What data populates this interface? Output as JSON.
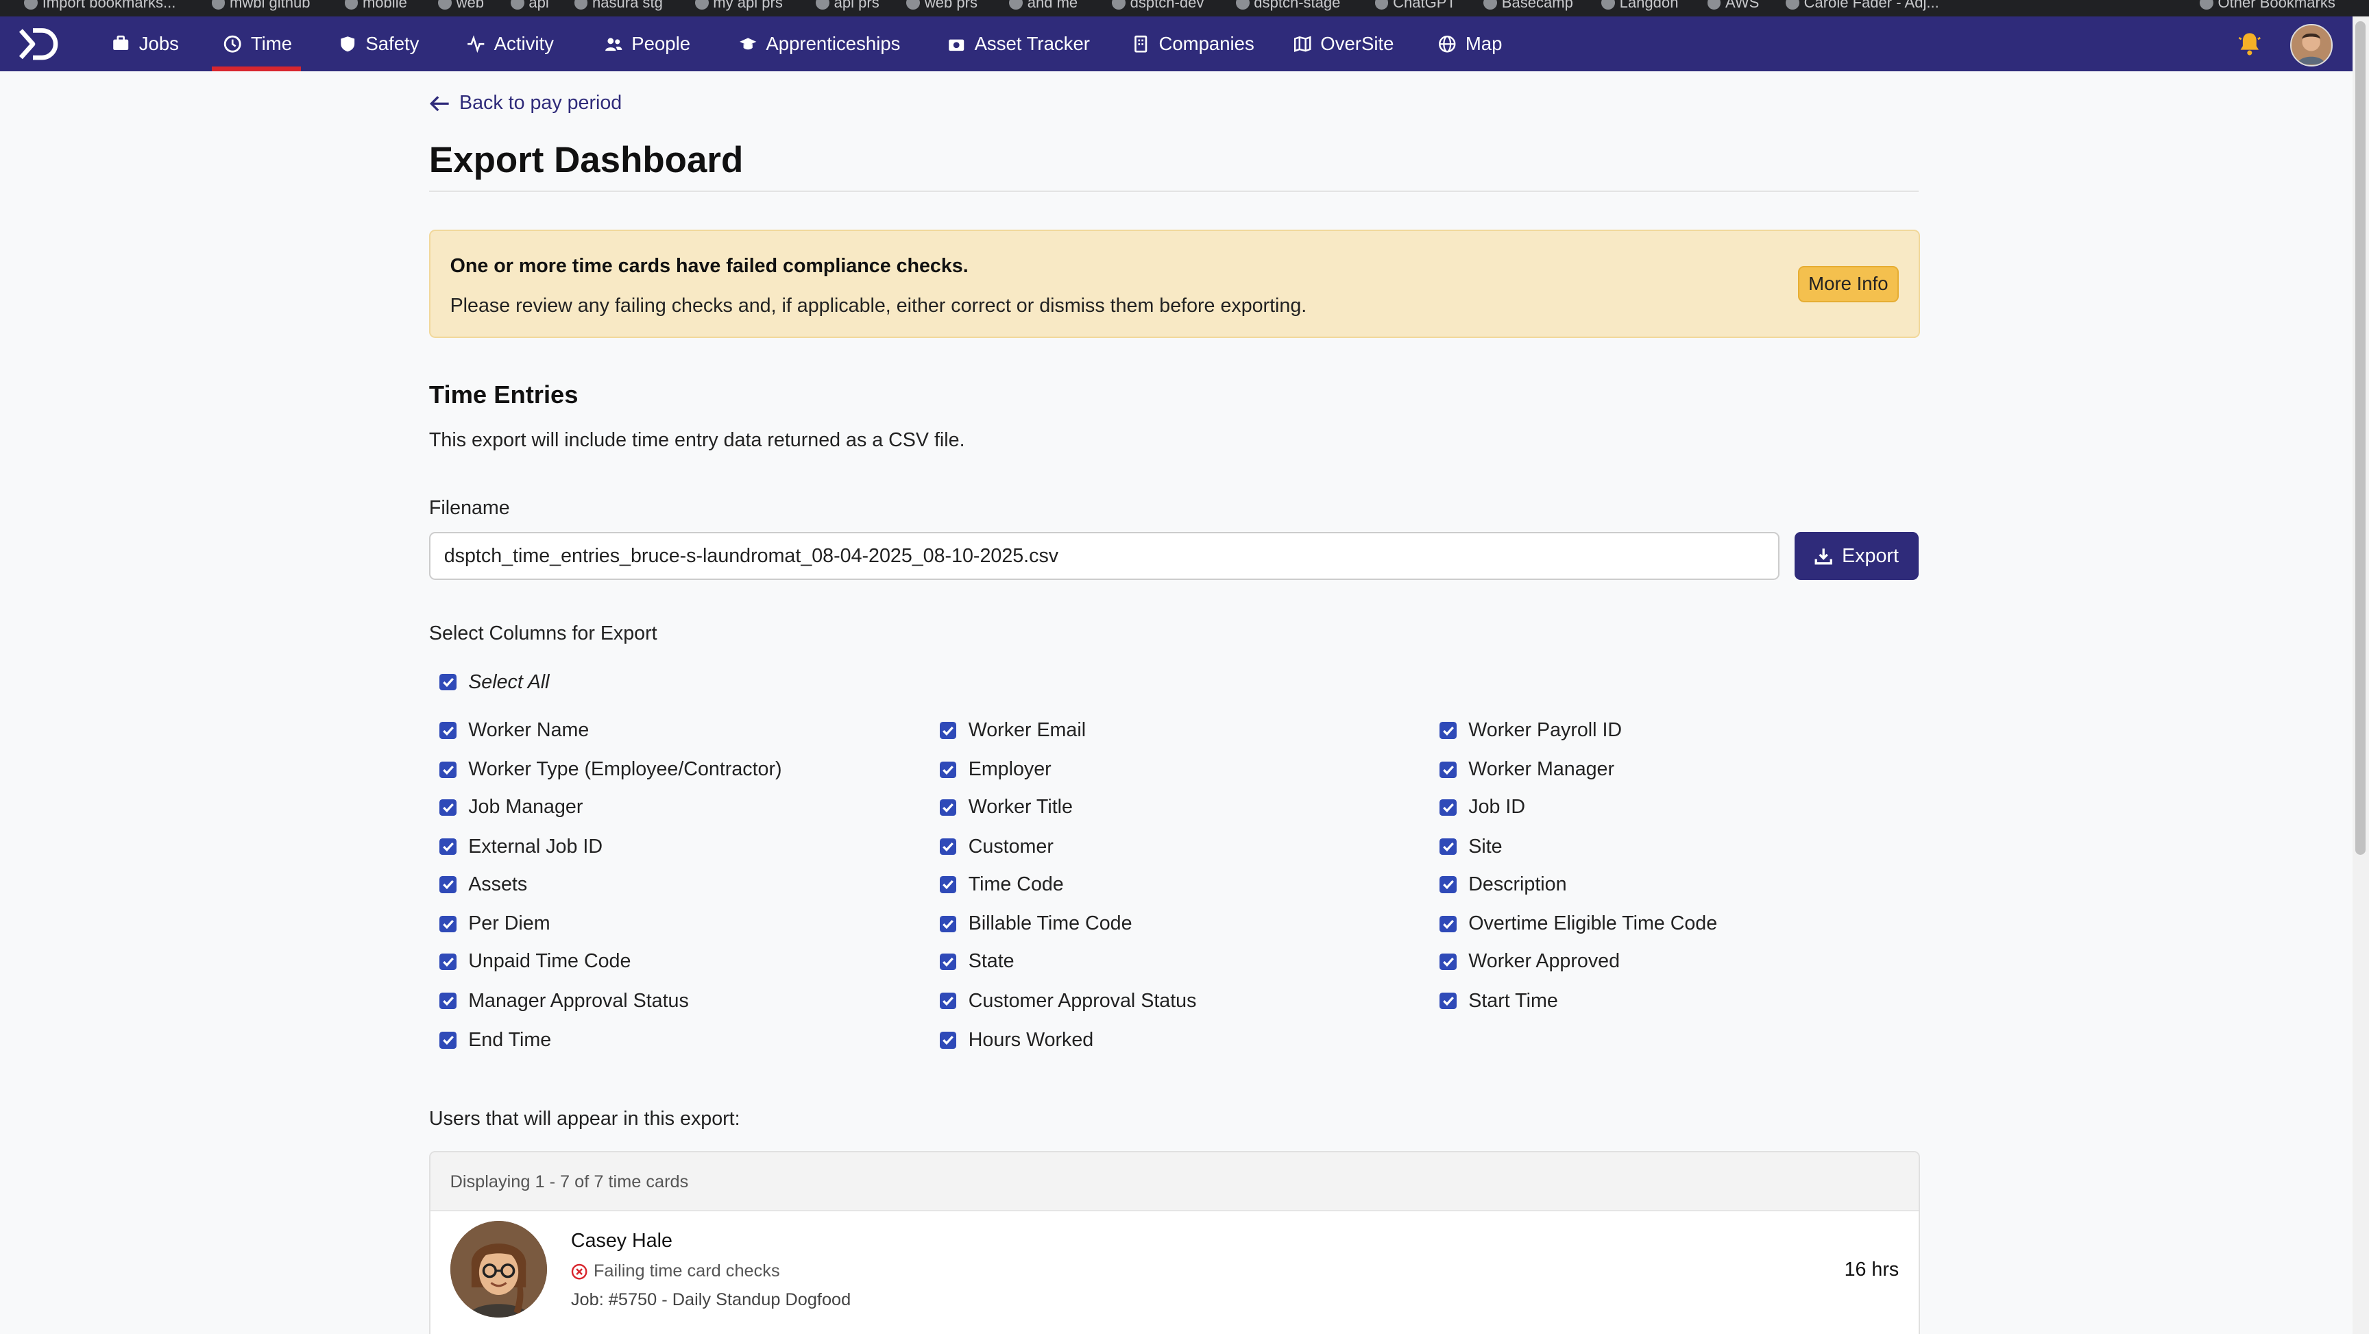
{
  "bookmarks": [
    "Import bookmarks...",
    "mwbl github",
    "mobile",
    "web",
    "api",
    "hasura stg",
    "my api prs",
    "api prs",
    "web prs",
    "and me",
    "dsptch-dev",
    "dsptch-stage",
    "ChatGPT",
    "Basecamp",
    "Langdon",
    "AWS",
    "Carole Fader - Adj...",
    "Other Bookmarks"
  ],
  "nav": {
    "items": [
      {
        "label": "Jobs",
        "icon": "briefcase-icon"
      },
      {
        "label": "Time",
        "icon": "clock-icon",
        "active": true
      },
      {
        "label": "Safety",
        "icon": "shield-icon"
      },
      {
        "label": "Activity",
        "icon": "activity-icon"
      },
      {
        "label": "People",
        "icon": "people-icon"
      },
      {
        "label": "Apprenticeships",
        "icon": "graduation-cap-icon"
      },
      {
        "label": "Asset Tracker",
        "icon": "camera-icon"
      },
      {
        "label": "Companies",
        "icon": "building-icon"
      },
      {
        "label": "OverSite",
        "icon": "map-fold-icon"
      },
      {
        "label": "Map",
        "icon": "globe-icon"
      }
    ]
  },
  "page": {
    "back_label": "Back to pay period",
    "title": "Export Dashboard"
  },
  "alert": {
    "heading": "One or more time cards have failed compliance checks.",
    "body": "Please review any failing checks and, if applicable, either correct or dismiss them before exporting.",
    "button": "More Info"
  },
  "time_entries": {
    "heading": "Time Entries",
    "description": "This export will include time entry data returned as a CSV file.",
    "filename_label": "Filename",
    "filename_value": "dsptch_time_entries_bruce-s-laundromat_08-04-2025_08-10-2025.csv",
    "export_button": "Export",
    "columns_label": "Select Columns for Export",
    "select_all": "Select All",
    "columns": [
      [
        "Worker Name",
        "Worker Email",
        "Worker Payroll ID"
      ],
      [
        "Worker Type (Employee/Contractor)",
        "Employer",
        "Worker Manager"
      ],
      [
        "Job Manager",
        "Worker Title",
        "Job ID"
      ],
      [
        "External Job ID",
        "Customer",
        "Site"
      ],
      [
        "Assets",
        "Time Code",
        "Description"
      ],
      [
        "Per Diem",
        "Billable Time Code",
        "Overtime Eligible Time Code"
      ],
      [
        "Unpaid Time Code",
        "State",
        "Worker Approved"
      ],
      [
        "Manager Approval Status",
        "Customer Approval Status",
        "Start Time"
      ],
      [
        "End Time",
        "Hours Worked",
        null
      ]
    ]
  },
  "users": {
    "label": "Users that will appear in this export:",
    "summary": "Displaying 1 - 7 of 7 time cards",
    "rows": [
      {
        "name": "Casey Hale",
        "status": "Failing time card checks",
        "job": "Job: #5750 - Daily Standup Dogfood",
        "hours": "16 hrs"
      }
    ]
  }
}
